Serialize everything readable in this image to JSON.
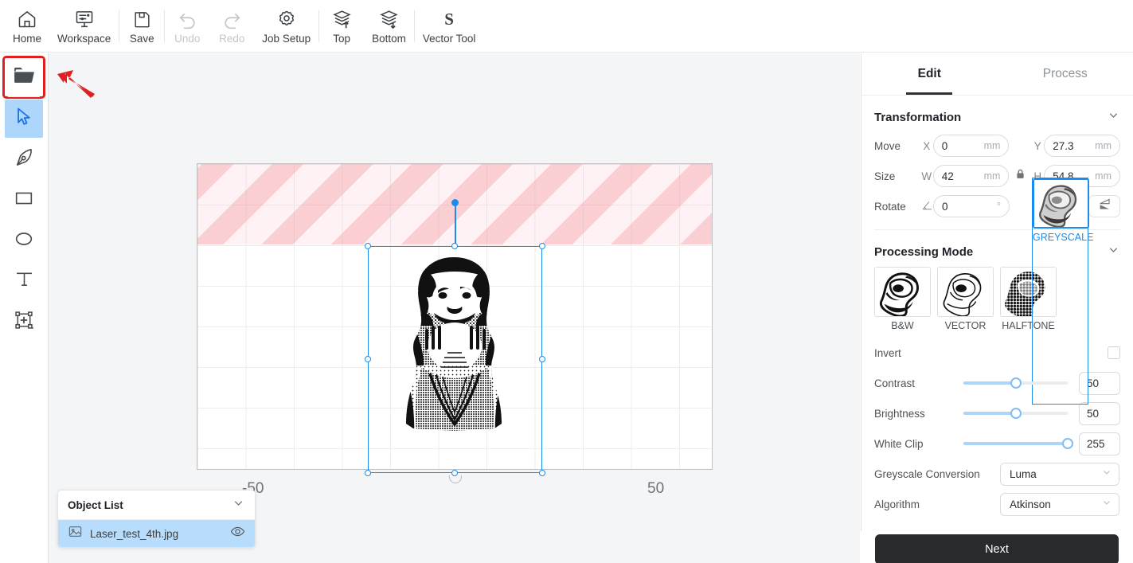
{
  "toolbar": {
    "items": [
      {
        "label": "Home",
        "icon": "home-icon",
        "disabled": false
      },
      {
        "label": "Workspace",
        "icon": "workspace-icon",
        "disabled": false
      },
      {
        "label": "Save",
        "icon": "save-icon",
        "disabled": false
      },
      {
        "label": "Undo",
        "icon": "undo-icon",
        "disabled": true
      },
      {
        "label": "Redo",
        "icon": "redo-icon",
        "disabled": true
      },
      {
        "label": "Job Setup",
        "icon": "gear-icon",
        "disabled": false
      },
      {
        "label": "Top",
        "icon": "bring-to-top-icon",
        "disabled": false
      },
      {
        "label": "Bottom",
        "icon": "send-to-bottom-icon",
        "disabled": false
      },
      {
        "label": "Vector Tool",
        "icon": "vector-tool-icon",
        "disabled": false
      }
    ]
  },
  "left_rail": {
    "items": [
      {
        "name": "open-file",
        "icon": "folder-open-icon",
        "state": "highlighted"
      },
      {
        "name": "select",
        "icon": "cursor-arrow-icon",
        "state": "active"
      },
      {
        "name": "pen",
        "icon": "pen-nib-icon",
        "state": "normal"
      },
      {
        "name": "rectangle",
        "icon": "rectangle-icon",
        "state": "normal"
      },
      {
        "name": "ellipse",
        "icon": "ellipse-icon",
        "state": "normal"
      },
      {
        "name": "text",
        "icon": "text-t-icon",
        "state": "normal"
      },
      {
        "name": "transform-frame",
        "icon": "transform-frame-icon",
        "state": "normal"
      }
    ]
  },
  "canvas": {
    "ruler_labels": {
      "left": "-50",
      "right": "50"
    },
    "nogo_color": "#f7a8af",
    "selection_color": "#1a8cf0"
  },
  "object_list": {
    "title": "Object List",
    "collapse_icon": "chevron-down-icon",
    "rows": [
      {
        "name": "Laser_test_4th.jpg",
        "thumb_icon": "image-icon",
        "visibility_icon": "eye-icon",
        "selected": true
      }
    ]
  },
  "right_panel": {
    "tabs": [
      {
        "label": "Edit",
        "active": true
      },
      {
        "label": "Process",
        "active": false
      }
    ],
    "transformation": {
      "title": "Transformation",
      "collapse_icon": "chevron-down-icon",
      "rows": [
        {
          "label": "Move",
          "a_axis": "X",
          "a_value": "0",
          "a_unit": "mm",
          "b_axis": "Y",
          "b_value": "27.3",
          "b_unit": "mm"
        },
        {
          "label": "Size",
          "a_axis": "W",
          "a_value": "42",
          "a_unit": "mm",
          "b_axis": "H",
          "b_value": "54.8",
          "b_unit": "mm",
          "lock_icon": "lock-closed-icon"
        },
        {
          "label": "Rotate",
          "a_axis": "angle-icon",
          "a_value": "0",
          "a_unit": "°"
        }
      ],
      "flip_horizontal_icon": "flip-horizontal-icon",
      "flip_vertical_icon": "flip-vertical-icon"
    },
    "processing_mode": {
      "title": "Processing Mode",
      "collapse_icon": "chevron-down-icon",
      "modes": [
        {
          "label": "B&W",
          "selected": false
        },
        {
          "label": "GREYSCALE",
          "selected": true
        },
        {
          "label": "VECTOR",
          "selected": false
        },
        {
          "label": "HALFTONE",
          "selected": false
        }
      ],
      "selected_color": "#1a8cf0",
      "invert": {
        "label": "Invert",
        "checked": false
      },
      "sliders": [
        {
          "label": "Contrast",
          "value": "50",
          "percent": 50
        },
        {
          "label": "Brightness",
          "value": "50",
          "percent": 50
        },
        {
          "label": "White Clip",
          "value": "255",
          "percent": 100
        }
      ],
      "selects": [
        {
          "label": "Greyscale Conversion",
          "value": "Luma",
          "icon": "chevron-down-icon"
        },
        {
          "label": "Algorithm",
          "value": "Atkinson",
          "icon": "chevron-down-icon"
        }
      ]
    },
    "next_button": {
      "label": "Next",
      "color": "#282b2e"
    }
  },
  "annotation": {
    "arrow_color": "#e02020",
    "highlight_color": "#e02020"
  }
}
